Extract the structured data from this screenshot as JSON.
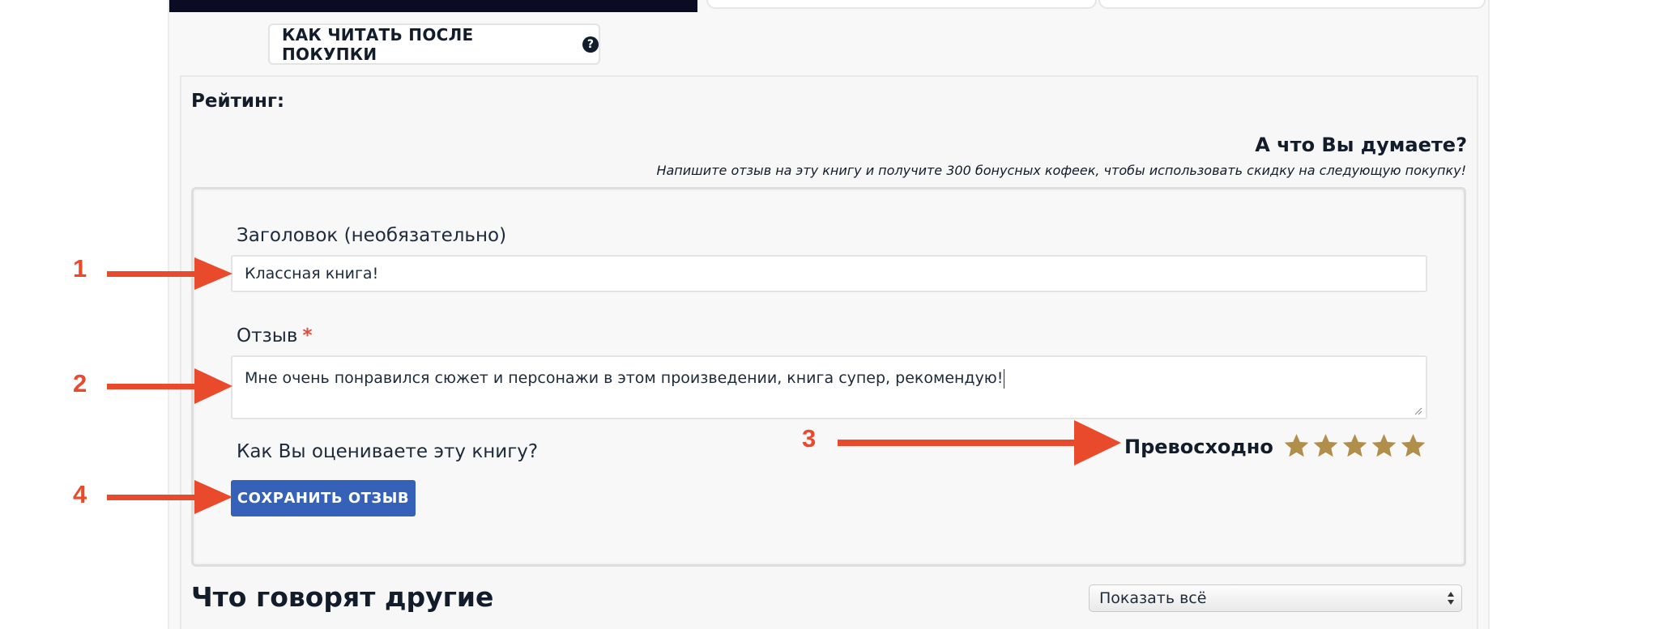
{
  "header": {
    "how_to_read_label": "КАК ЧИТАТЬ ПОСЛЕ ПОКУПКИ",
    "help_icon_glyph": "?"
  },
  "rating": {
    "label": "Рейтинг:"
  },
  "prompt": {
    "title": "А что Вы думаете?",
    "subtitle": "Напишите отзыв на эту книгу и получите 300 бонусных кофеек, чтобы использовать скидку на следующую покупку!"
  },
  "form": {
    "title_label": "Заголовок (необязательно)",
    "title_value": "Классная книга!",
    "review_label": "Отзыв",
    "required_mark": "*",
    "review_value": "Мне очень понравился сюжет и персонажи в этом произведении, книга супер, рекомендую!",
    "rating_question": "Как Вы оцениваете эту книгу?",
    "rating_word": "Превосходно",
    "rating_value": 5,
    "rating_max": 5,
    "star_color": "#b18e4a",
    "save_label": "СОХРАНИТЬ ОТЗЫВ",
    "save_color": "#3561b8"
  },
  "others": {
    "title": "Что говорят другие",
    "filter_selected": "Показать всё"
  },
  "annotations": {
    "color": "#ea4a2c",
    "labels": [
      "1",
      "2",
      "3",
      "4"
    ]
  }
}
